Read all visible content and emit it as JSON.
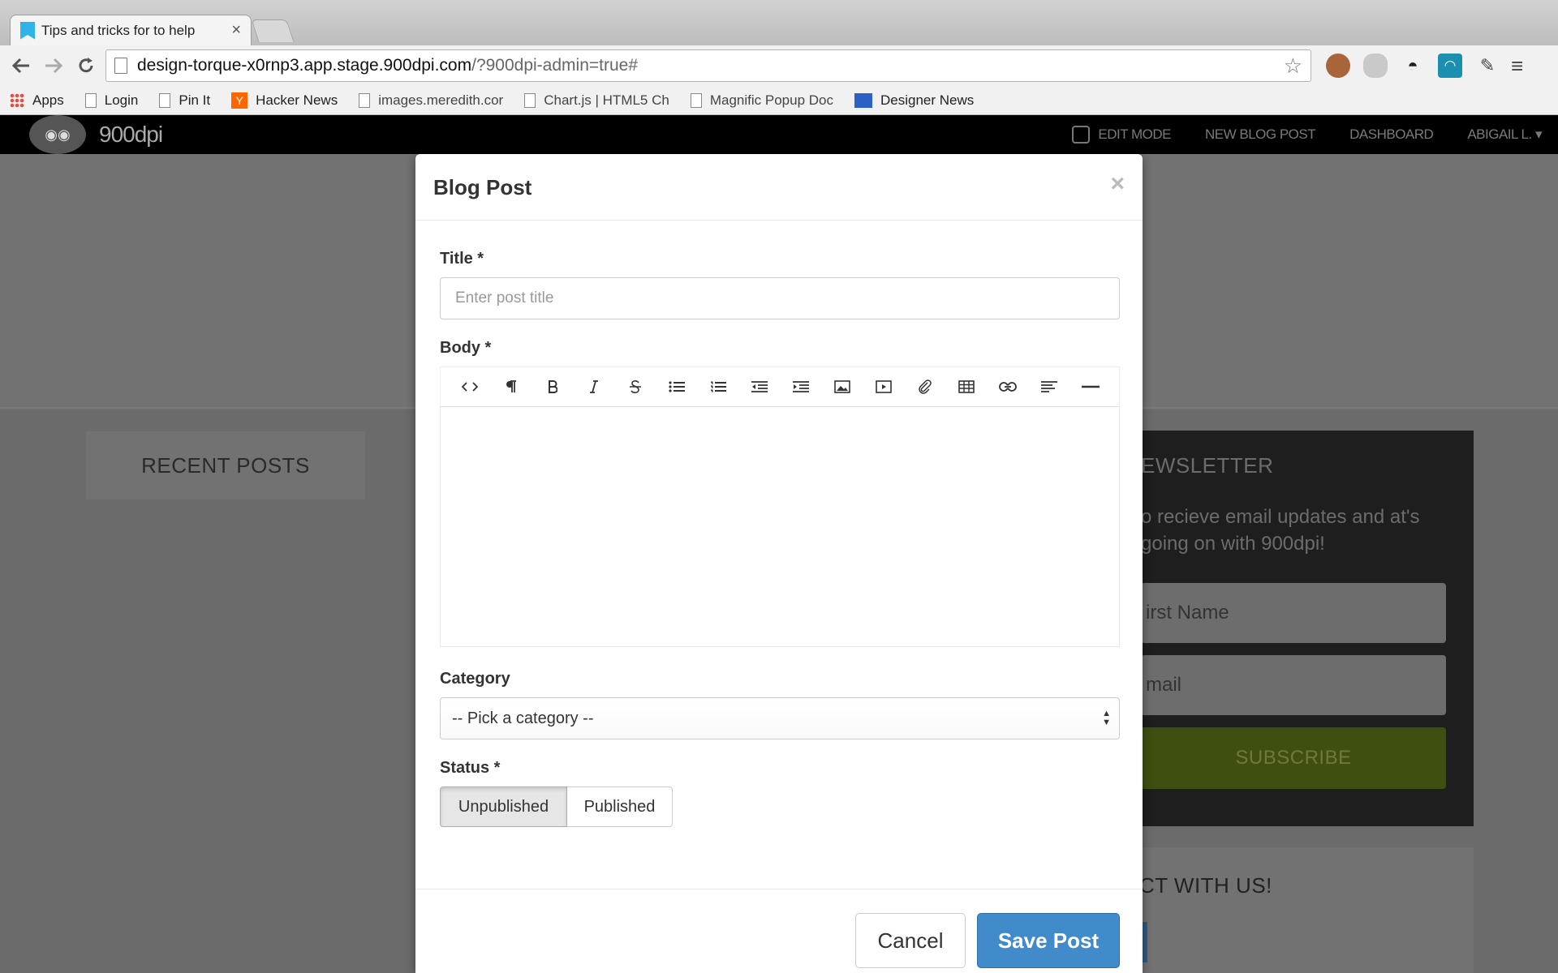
{
  "browser": {
    "tab": {
      "title": "Tips and tricks for to help",
      "close": "×"
    },
    "url": {
      "host": "design-torque-x0rnp3.app.stage.900dpi.com",
      "path": "/?900dpi-admin=true#"
    },
    "bookmarks": [
      {
        "label": "Apps",
        "icon": "apps-icon"
      },
      {
        "label": "Login",
        "icon": "page-icon"
      },
      {
        "label": "Pin It",
        "icon": "page-icon"
      },
      {
        "label": "Hacker News",
        "icon": "hacker-news-icon"
      },
      {
        "label": "images.meredith.cor",
        "icon": "page-icon"
      },
      {
        "label": "Chart.js | HTML5 Ch",
        "icon": "page-icon"
      },
      {
        "label": "Magnific Popup Doc",
        "icon": "page-icon"
      },
      {
        "label": "Designer News",
        "icon": "designer-news-icon"
      }
    ],
    "hn_glyph": "Y"
  },
  "site": {
    "logo_text": "900dpi",
    "nav": {
      "edit_mode": "EDIT MODE",
      "new_blog_post": "NEW BLOG POST",
      "dashboard": "DASHBOARD",
      "user": "ABIGAIL L. ▾"
    },
    "recent_posts": "RECENT POSTS",
    "newsletter": {
      "title": "EWSLETTER",
      "desc": "o recieve email updates and at's going on with 900dpi!",
      "first_name": "irst Name",
      "email": "mail",
      "subscribe": "SUBSCRIBE"
    },
    "connect_title": "CT WITH US!"
  },
  "modal": {
    "title": "Blog Post",
    "close": "×",
    "title_label": "Title *",
    "title_placeholder": "Enter post title",
    "body_label": "Body *",
    "toolbar_icons": [
      "html-icon",
      "paragraph-icon",
      "bold-icon",
      "italic-icon",
      "strikethrough-icon",
      "unordered-list-icon",
      "ordered-list-icon",
      "outdent-icon",
      "indent-icon",
      "image-icon",
      "video-icon",
      "file-link-icon",
      "table-icon",
      "link-icon",
      "align-icon",
      "horizontal-rule-icon"
    ],
    "category_label": "Category",
    "category_selected": "-- Pick a category --",
    "status_label": "Status *",
    "status_options": [
      "Unpublished",
      "Published"
    ],
    "status_selected": "Unpublished",
    "cancel": "Cancel",
    "save": "Save Post"
  },
  "colors": {
    "primary": "#428bca",
    "subscribe": "#7a9a1e",
    "overlay": "rgba(0,0,0,0.5)"
  }
}
